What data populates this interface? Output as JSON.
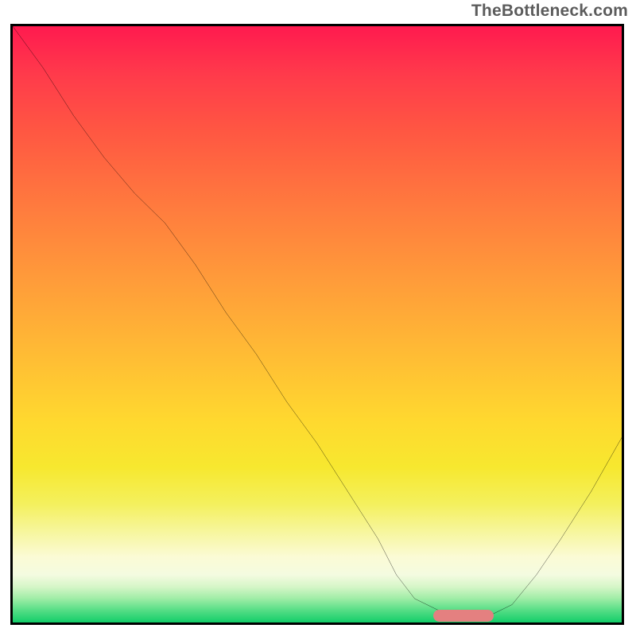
{
  "watermark": "TheBottleneck.com",
  "chart_data": {
    "type": "line",
    "title": "",
    "xlabel": "",
    "ylabel": "",
    "xlim": [
      0,
      100
    ],
    "ylim": [
      0,
      100
    ],
    "grid": false,
    "background_gradient": {
      "top": "#ff1a4f",
      "mid": "#ffd82f",
      "bottom": "#13cd69"
    },
    "series": [
      {
        "name": "bottleneck-curve",
        "color": "#000000",
        "x": [
          0,
          5,
          10,
          15,
          20,
          25,
          30,
          35,
          40,
          45,
          50,
          55,
          60,
          63,
          66,
          70,
          74,
          78,
          82,
          86,
          90,
          95,
          100
        ],
        "y": [
          100,
          93,
          85,
          78,
          72,
          67,
          60,
          52,
          45,
          37,
          30,
          22,
          14,
          8,
          4,
          2,
          1,
          1,
          3,
          8,
          14,
          22,
          31
        ]
      }
    ],
    "annotations": [
      {
        "name": "optimal-range-marker",
        "type": "bar",
        "color": "#e48080",
        "x_start": 69,
        "x_end": 79,
        "y": 1.1,
        "height_pct": 2
      }
    ]
  }
}
